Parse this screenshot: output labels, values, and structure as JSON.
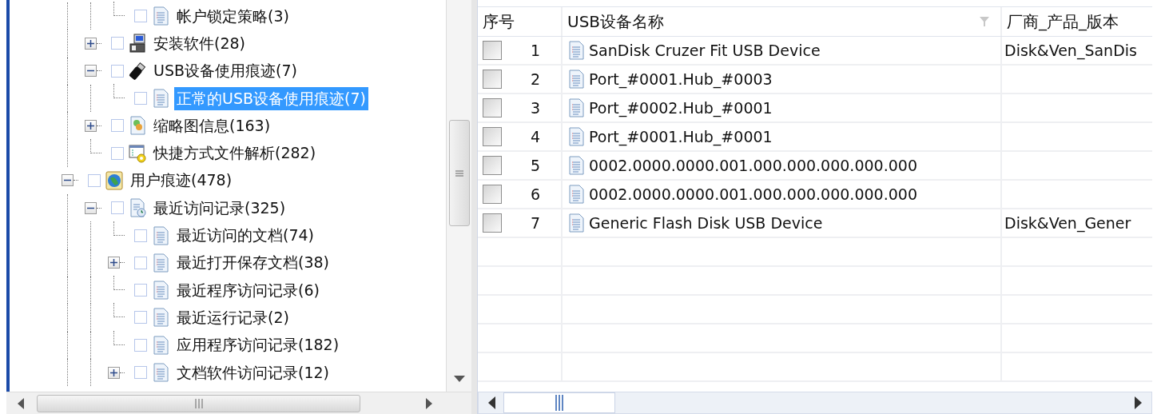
{
  "tree": {
    "items": [
      {
        "children": [
          {
            "children": [
              {
                "label": "帐户锁定策略(3)",
                "kind": "doc",
                "checked": false,
                "selected": false
              }
            ]
          },
          {
            "label": "安装软件(28)",
            "kind": "software",
            "checked": false,
            "selected": false,
            "expanded": false
          },
          {
            "label": "USB设备使用痕迹(7)",
            "kind": "usb",
            "checked": false,
            "selected": false,
            "expanded": true,
            "children": [
              {
                "label": "正常的USB设备使用痕迹(7)",
                "kind": "doc",
                "checked": false,
                "selected": true
              }
            ]
          },
          {
            "label": "缩略图信息(163)",
            "kind": "thumbnail",
            "checked": false,
            "selected": false,
            "expanded": false
          },
          {
            "label": "快捷方式文件解析(282)",
            "kind": "shortcut",
            "checked": false,
            "selected": false
          }
        ]
      },
      {
        "label": "用户痕迹(478)",
        "kind": "globe",
        "checked": false,
        "selected": false,
        "expanded": true,
        "children": [
          {
            "label": "最近访问记录(325)",
            "kind": "recent",
            "checked": false,
            "selected": false,
            "expanded": true,
            "children": [
              {
                "label": "最近访问的文档(74)",
                "kind": "doc",
                "checked": false,
                "selected": false
              },
              {
                "label": "最近打开保存文档(38)",
                "kind": "doc",
                "checked": false,
                "selected": false,
                "expanded": false
              },
              {
                "label": "最近程序访问记录(6)",
                "kind": "doc",
                "checked": false,
                "selected": false
              },
              {
                "label": "最近运行记录(2)",
                "kind": "doc",
                "checked": false,
                "selected": false
              },
              {
                "label": "应用程序访问记录(182)",
                "kind": "doc",
                "checked": false,
                "selected": false
              },
              {
                "label": "文档软件访问记录(12)",
                "kind": "doc",
                "checked": false,
                "selected": false,
                "expanded": false
              }
            ]
          }
        ]
      }
    ]
  },
  "table": {
    "columns": [
      {
        "label": "序号"
      },
      {
        "label": "USB设备名称",
        "filter": true
      },
      {
        "label": "厂商_产品_版本"
      }
    ],
    "rows": [
      {
        "checked": false,
        "number": "1",
        "name": "SanDisk Cruzer Fit USB Device",
        "vendor": "Disk&Ven_SanDis"
      },
      {
        "checked": false,
        "number": "2",
        "name": "Port_#0001.Hub_#0003"
      },
      {
        "checked": false,
        "number": "3",
        "name": "Port_#0002.Hub_#0001"
      },
      {
        "checked": false,
        "number": "4",
        "name": "Port_#0001.Hub_#0001"
      },
      {
        "checked": false,
        "number": "5",
        "name": "0002.0000.0000.001.000.000.000.000.000"
      },
      {
        "checked": false,
        "number": "6",
        "name": "0002.0000.0000.001.000.000.000.000.000"
      },
      {
        "checked": false,
        "number": "7",
        "name": "Generic Flash Disk USB Device",
        "vendor": "Disk&Ven_Gener"
      }
    ]
  }
}
